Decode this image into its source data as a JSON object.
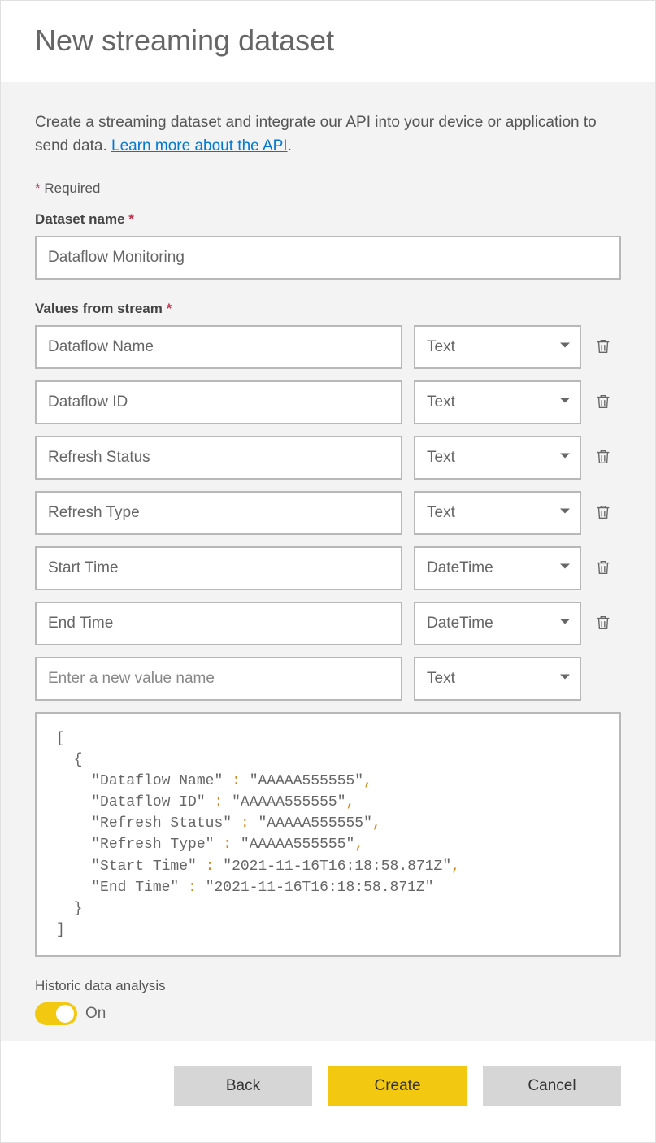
{
  "header": {
    "title": "New streaming dataset"
  },
  "desc": {
    "text_before": "Create a streaming dataset and integrate our API into your device or application to send data. ",
    "link_text": "Learn more about the API",
    "text_after": "."
  },
  "required_note": "Required",
  "dataset": {
    "label": "Dataset name",
    "value": "Dataflow Monitoring"
  },
  "stream": {
    "label": "Values from stream",
    "rows": [
      {
        "name": "Dataflow Name",
        "type": "Text"
      },
      {
        "name": "Dataflow ID",
        "type": "Text"
      },
      {
        "name": "Refresh Status",
        "type": "Text"
      },
      {
        "name": "Refresh Type",
        "type": "Text"
      },
      {
        "name": "Start Time",
        "type": "DateTime"
      },
      {
        "name": "End Time",
        "type": "DateTime"
      }
    ],
    "new_row": {
      "placeholder": "Enter a new value name",
      "type": "Text"
    }
  },
  "json_preview": {
    "lines": [
      {
        "indent": 0,
        "raw": "["
      },
      {
        "indent": 1,
        "raw": "{"
      },
      {
        "indent": 2,
        "key": "Dataflow Name",
        "val": "AAAAA555555",
        "comma": true
      },
      {
        "indent": 2,
        "key": "Dataflow ID",
        "val": "AAAAA555555",
        "comma": true
      },
      {
        "indent": 2,
        "key": "Refresh Status",
        "val": "AAAAA555555",
        "comma": true
      },
      {
        "indent": 2,
        "key": "Refresh Type",
        "val": "AAAAA555555",
        "comma": true
      },
      {
        "indent": 2,
        "key": "Start Time",
        "val": "2021-11-16T16:18:58.871Z",
        "comma": true
      },
      {
        "indent": 2,
        "key": "End Time",
        "val": "2021-11-16T16:18:58.871Z",
        "comma": false
      },
      {
        "indent": 1,
        "raw": "}"
      },
      {
        "indent": 0,
        "raw": "]"
      }
    ]
  },
  "historic": {
    "label": "Historic data analysis",
    "state_text": "On"
  },
  "footer": {
    "back": "Back",
    "create": "Create",
    "cancel": "Cancel"
  }
}
